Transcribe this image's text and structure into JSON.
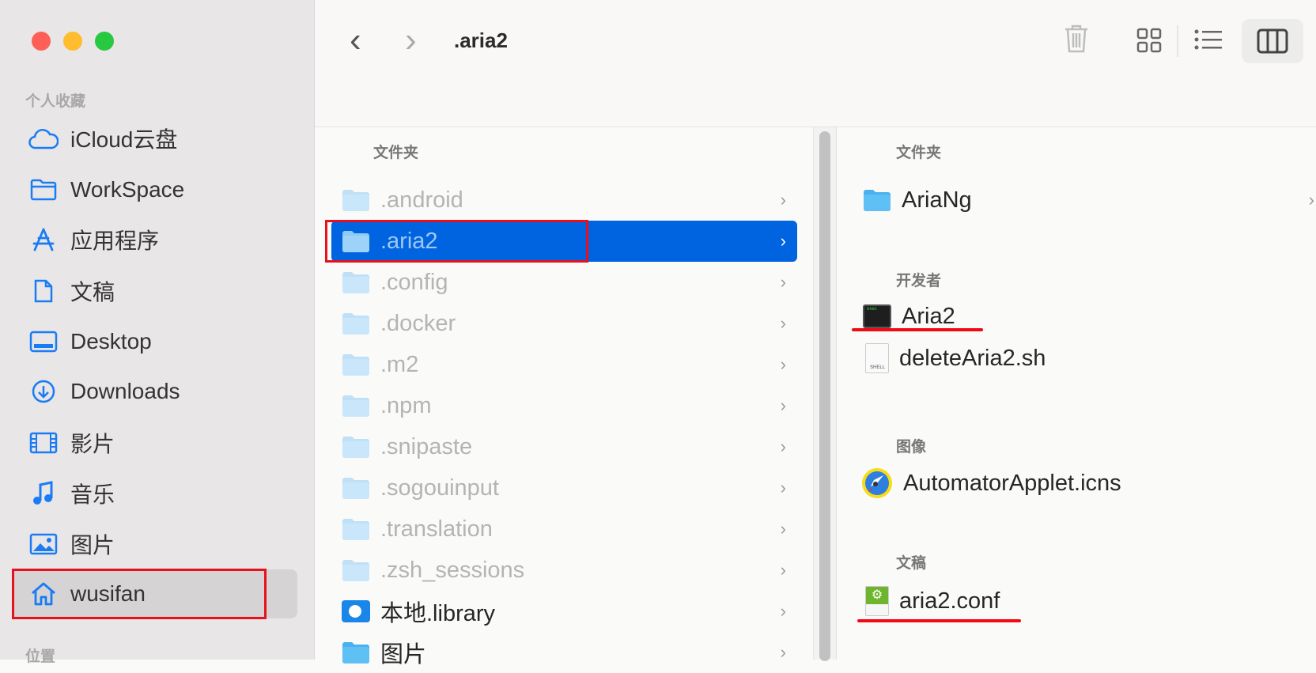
{
  "window": {
    "traffic_lights": [
      "#fe5f57",
      "#febc2e",
      "#28c840"
    ]
  },
  "sidebar": {
    "favorites_header": "个人收藏",
    "locations_header": "位置",
    "items": [
      {
        "label": "iCloud云盘",
        "icon": "cloud-icon"
      },
      {
        "label": "WorkSpace",
        "icon": "folder-icon"
      },
      {
        "label": "应用程序",
        "icon": "applications-icon"
      },
      {
        "label": "文稿",
        "icon": "document-icon"
      },
      {
        "label": "Desktop",
        "icon": "desktop-icon"
      },
      {
        "label": "Downloads",
        "icon": "download-icon"
      },
      {
        "label": "影片",
        "icon": "film-icon"
      },
      {
        "label": "音乐",
        "icon": "music-icon"
      },
      {
        "label": "图片",
        "icon": "photo-icon"
      },
      {
        "label": "wusifan",
        "icon": "home-icon",
        "selected": true
      }
    ]
  },
  "toolbar": {
    "title": ".aria2",
    "back": "‹",
    "forward": "›"
  },
  "middle": {
    "header": "文件夹",
    "items": [
      {
        "name": ".android",
        "hidden": true
      },
      {
        "name": ".aria2",
        "hidden": true,
        "selected": true
      },
      {
        "name": ".config",
        "hidden": true
      },
      {
        "name": ".docker",
        "hidden": true
      },
      {
        "name": ".m2",
        "hidden": true
      },
      {
        "name": ".npm",
        "hidden": true
      },
      {
        "name": ".snipaste",
        "hidden": true
      },
      {
        "name": ".sogouinput",
        "hidden": true
      },
      {
        "name": ".translation",
        "hidden": true
      },
      {
        "name": ".zsh_sessions",
        "hidden": true
      },
      {
        "name": "本地.library",
        "hidden": false
      },
      {
        "name": "图片",
        "hidden": false
      }
    ]
  },
  "right": {
    "folders_header": "文件夹",
    "folder": "AriaNg",
    "dev_header": "开发者",
    "exec": "Aria2",
    "shell": "deleteAria2.sh",
    "shell_badge": "SHELL",
    "exec_badge": "exec",
    "images_header": "图像",
    "image": "AutomatorApplet.icns",
    "docs_header": "文稿",
    "doc": "aria2.conf"
  },
  "accent": "#0064e1",
  "annotation_color": "#e8101c"
}
